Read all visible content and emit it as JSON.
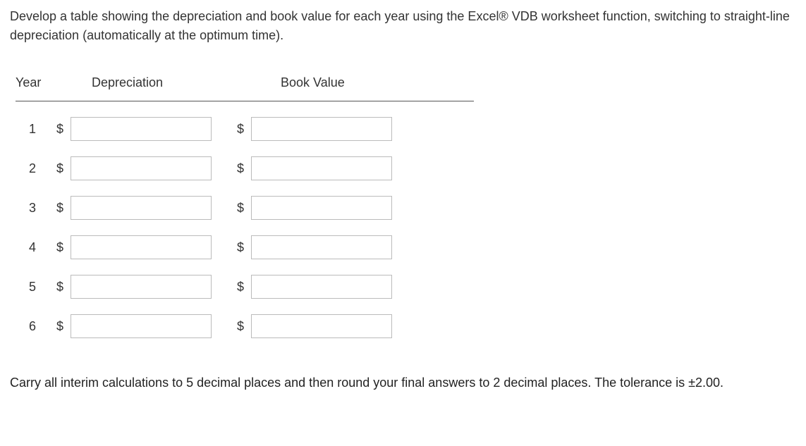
{
  "intro": "Develop a table showing the depreciation and book value for each year using the Excel® VDB worksheet function, switching to straight-line depreciation (automatically at the optimum time).",
  "headers": {
    "year": "Year",
    "depreciation": "Depreciation",
    "book_value": "Book Value"
  },
  "currency": "$",
  "rows": [
    {
      "year": "1",
      "depreciation": "",
      "book_value": ""
    },
    {
      "year": "2",
      "depreciation": "",
      "book_value": ""
    },
    {
      "year": "3",
      "depreciation": "",
      "book_value": ""
    },
    {
      "year": "4",
      "depreciation": "",
      "book_value": ""
    },
    {
      "year": "5",
      "depreciation": "",
      "book_value": ""
    },
    {
      "year": "6",
      "depreciation": "",
      "book_value": ""
    }
  ],
  "footnote": "Carry all interim calculations to 5 decimal places and then round your final answers to 2 decimal places. The tolerance is ±2.00."
}
